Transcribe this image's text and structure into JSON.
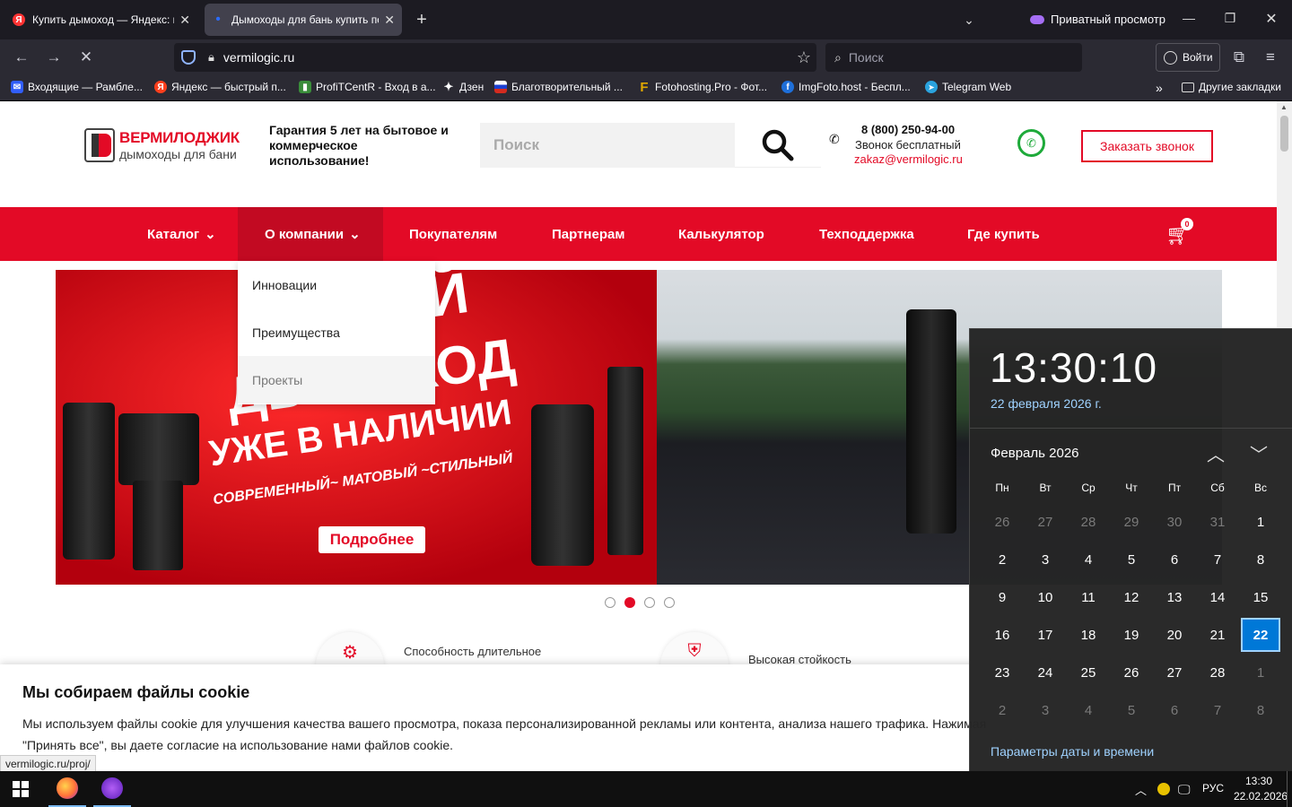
{
  "browser": {
    "tabs": [
      {
        "title": "Купить дымоход — Яндекс: на",
        "fav": "Я",
        "favColor": "#f33"
      },
      {
        "title": "Дымоходы для бань купить по",
        "fav": "•",
        "favColor": "#2b6cff"
      }
    ],
    "private_label": "Приватный просмотр",
    "url": "vermilogic.ru",
    "search_placeholder": "Поиск",
    "login_label": "Войти",
    "bookmarks": [
      {
        "label": "Входящие — Рамбле...",
        "fav": "✉",
        "color": "#315efb"
      },
      {
        "label": "Яндекс — быстрый п...",
        "fav": "Я",
        "color": "#fc3f1d"
      },
      {
        "label": "ProfiTCentR - Вход в а...",
        "fav": "▮",
        "color": "#3a8d3a"
      },
      {
        "label": "Дзен",
        "fav": "✦",
        "color": "#2b2a33"
      },
      {
        "label": "Благотворительный ...",
        "fav": "▬",
        "color": "#d52b1e"
      },
      {
        "label": "Fotohosting.Pro - Фот...",
        "fav": "F",
        "color": "#e0a800"
      },
      {
        "label": "ImgFoto.host - Беспл...",
        "fav": "f",
        "color": "#1e6fd9"
      },
      {
        "label": "Telegram Web",
        "fav": "➤",
        "color": "#2aa3de"
      }
    ],
    "other_bookmarks": "Другие закладки"
  },
  "site": {
    "logo_name": "ВЕРМИЛОДЖИК",
    "logo_sub": "дымоходы для бани",
    "guarantee": "Гарантия 5 лет на бытовое и коммерческое использование!",
    "search_placeholder": "Поиск",
    "phone": "8 (800) 250-94-00",
    "phone_note": "Звонок бесплатный",
    "email": "zakaz@vermilogic.ru",
    "callback_label": "Заказать звонок",
    "menu": [
      "Каталог",
      "О компании",
      "Покупателям",
      "Партнерам",
      "Калькулятор",
      "Техподдержка",
      "Где купить"
    ],
    "cart_count": "0",
    "dropdown": [
      "Инновации",
      "Преимущества",
      "Проекты"
    ],
    "banner_line1": "НОВЫЙ",
    "banner_line2": "ДЫМОХОД",
    "banner_line3": "УЖЕ В НАЛИЧИИ",
    "banner_line4": "СОВРЕМЕННЫЙ~ МАТОВЫЙ ~СТИЛЬНЫЙ",
    "banner_button": "Подробнее",
    "slider_active": 1,
    "slider_count": 4,
    "feature1": "Способность длительное",
    "feature2": "Высокая стойкость",
    "cookie_title": "Мы собираем файлы cookie",
    "cookie_text1": "Мы используем файлы cookie для улучшения качества вашего просмотра, показа персонализированной рекламы или контента, анализа нашего трафика. Нажимая",
    "cookie_text2": "\"Принять все\", вы даете согласие на использование нами файлов cookie.",
    "status_url": "vermilogic.ru/proj/"
  },
  "calendar": {
    "time": "13:30:10",
    "date_long": "22 февраля 2026 г.",
    "month_label": "Февраль 2026",
    "weekdays": [
      "Пн",
      "Вт",
      "Ср",
      "Чт",
      "Пт",
      "Сб",
      "Вс"
    ],
    "days": [
      [
        "26",
        "27",
        "28",
        "29",
        "30",
        "31",
        "1"
      ],
      [
        "2",
        "3",
        "4",
        "5",
        "6",
        "7",
        "8"
      ],
      [
        "9",
        "10",
        "11",
        "12",
        "13",
        "14",
        "15"
      ],
      [
        "16",
        "17",
        "18",
        "19",
        "20",
        "21",
        "22"
      ],
      [
        "23",
        "24",
        "25",
        "26",
        "27",
        "28",
        "1"
      ],
      [
        "2",
        "3",
        "4",
        "5",
        "6",
        "7",
        "8"
      ]
    ],
    "settings_link": "Параметры даты и времени",
    "today": "22"
  },
  "taskbar": {
    "lang": "РУС",
    "time": "13:30",
    "date": "22.02.2026"
  }
}
